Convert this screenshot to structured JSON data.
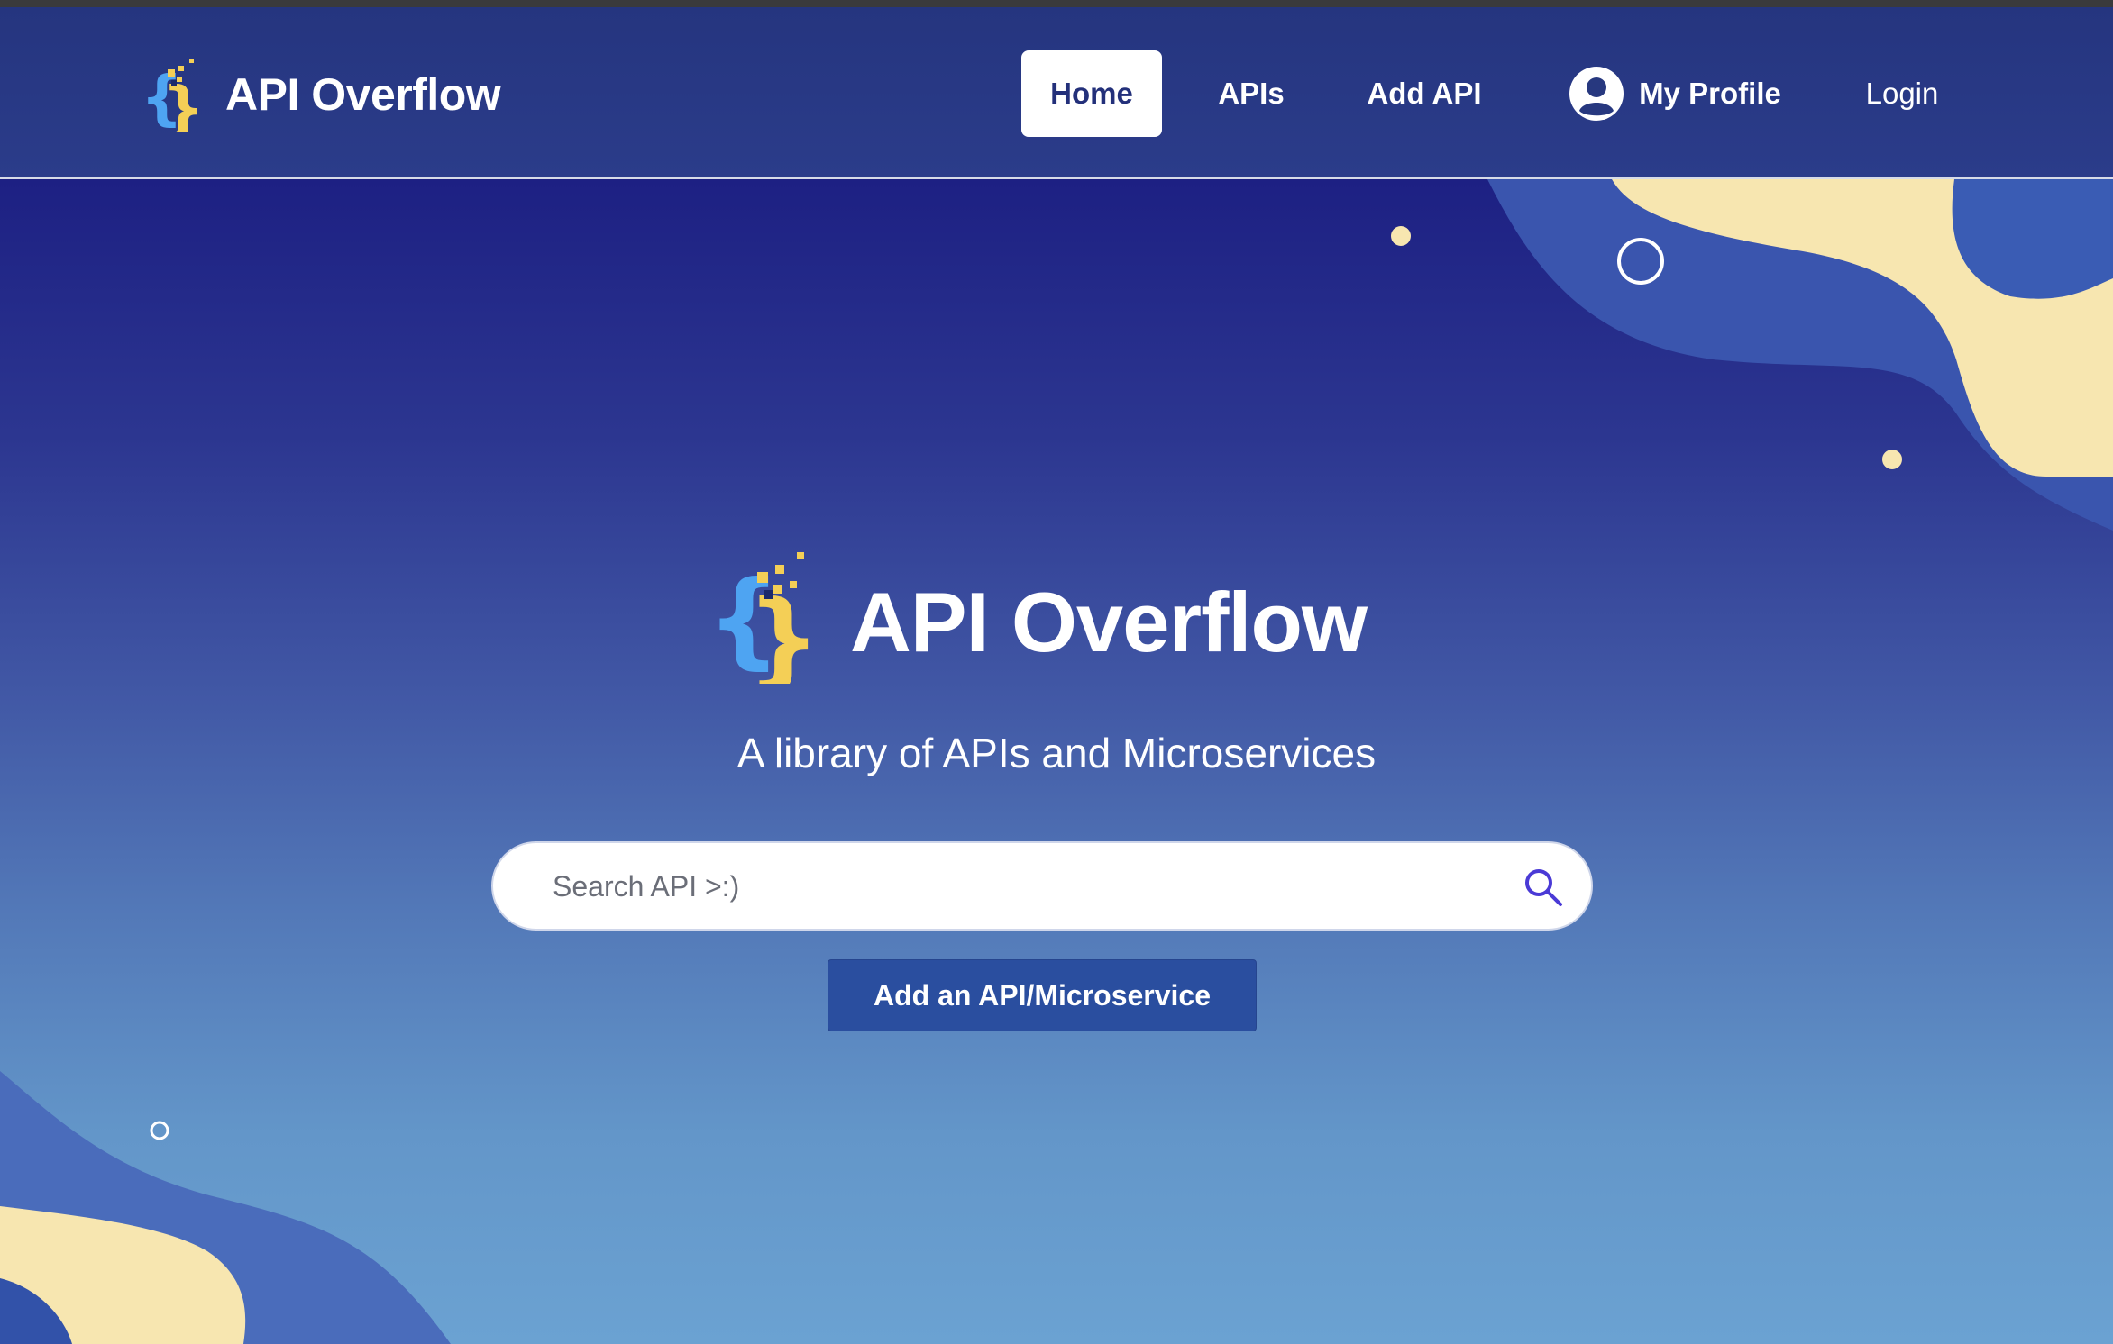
{
  "navbar": {
    "brand": "API Overflow",
    "items": [
      {
        "label": "Home"
      },
      {
        "label": "APIs"
      },
      {
        "label": "Add API"
      },
      {
        "label": "My Profile"
      },
      {
        "label": "Login"
      }
    ],
    "active_item": "Home"
  },
  "hero": {
    "title": "API Overflow",
    "tagline": "A library of APIs and Microservices"
  },
  "search": {
    "placeholder": "Search API >:)",
    "value": ""
  },
  "cta": {
    "label": "Add an API/Microservice"
  },
  "icons": {
    "logo": "curly-braces-logo-icon",
    "profile": "user-circle-icon",
    "search": "magnifier-icon"
  },
  "colors": {
    "navbar_bg": "#27387f",
    "hero_top": "#1d2083",
    "hero_bottom": "#6ba2d2",
    "accent_cream": "#f7e6b0",
    "logo_blue": "#4ea4f2",
    "logo_yellow": "#f4cf56",
    "button_bg": "#2a4e9f",
    "search_icon": "#4a3ad6"
  }
}
